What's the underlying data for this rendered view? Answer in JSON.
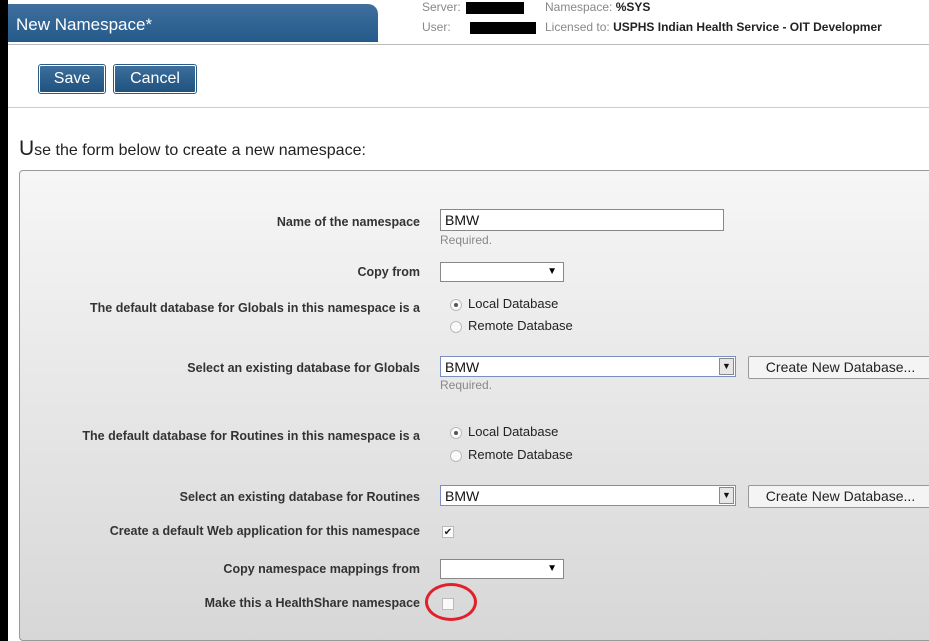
{
  "header": {
    "title": "New Namespace*",
    "server_label": "Server:",
    "user_label": "User:",
    "namespace_label": "Namespace:",
    "namespace_value": "%SYS",
    "licensed_label": "Licensed to:",
    "licensed_value": "USPHS Indian Health Service - OIT Developmer"
  },
  "toolbar": {
    "save_label": "Save",
    "cancel_label": "Cancel"
  },
  "intro": {
    "first_letter": "U",
    "rest": "se the form below to create a new namespace:"
  },
  "form": {
    "name_label": "Name of the namespace",
    "name_value": "BMW",
    "required_text": "Required.",
    "copy_from_label": "Copy from",
    "globals_default_label": "The default database for Globals in this namespace is a",
    "local_db": "Local Database",
    "remote_db": "Remote Database",
    "globals_select_label": "Select an existing database for Globals",
    "globals_value": "BMW",
    "create_db_label": "Create New Database...",
    "routines_default_label": "The default database for Routines in this namespace is a",
    "routines_select_label": "Select an existing database for Routines",
    "routines_value": "BMW",
    "web_app_label": "Create a default Web application for this namespace",
    "mappings_label": "Copy namespace mappings from",
    "healthshare_label": "Make this a HealthShare namespace"
  },
  "colors": {
    "header_blue": "#245a8a",
    "annotation_red": "#e0202a"
  }
}
